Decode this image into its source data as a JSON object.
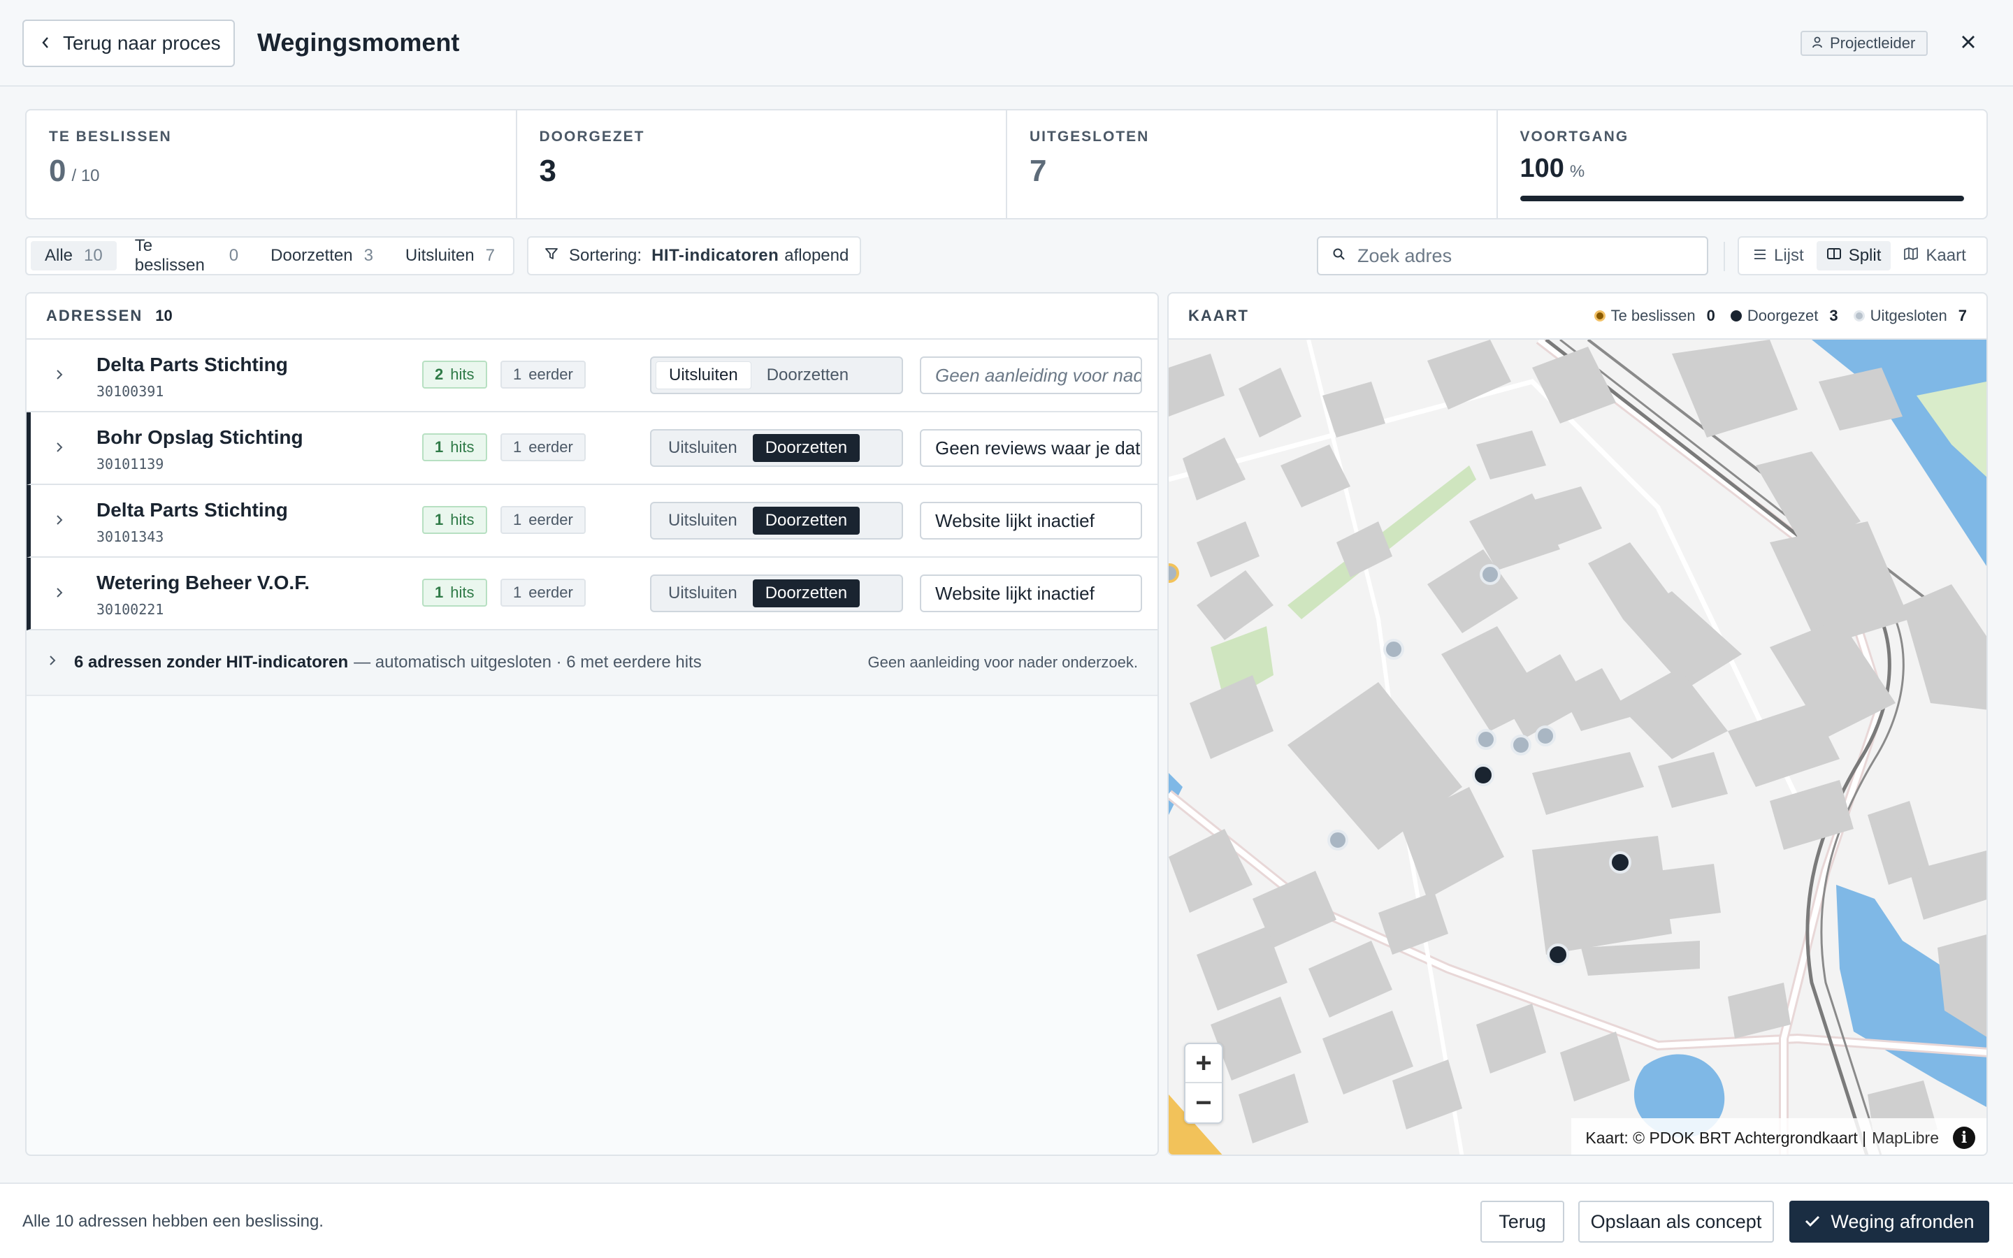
{
  "header": {
    "back_label": "Terug naar proces",
    "title": "Wegingsmoment",
    "role": "Projectleider"
  },
  "stats": {
    "to_decide": {
      "label": "TE BESLISSEN",
      "value": "0",
      "total": "/ 10"
    },
    "forwarded": {
      "label": "DOORGEZET",
      "value": "3"
    },
    "excluded": {
      "label": "UITGESLOTEN",
      "value": "7"
    },
    "progress": {
      "label": "VOORTGANG",
      "value": "100",
      "unit": "%",
      "fraction": 1.0
    }
  },
  "filters": [
    {
      "label": "Alle",
      "count": "10",
      "active": true
    },
    {
      "label": "Te beslissen",
      "count": "0",
      "active": false
    },
    {
      "label": "Doorzetten",
      "count": "3",
      "active": false
    },
    {
      "label": "Uitsluiten",
      "count": "7",
      "active": false
    }
  ],
  "sort": {
    "prefix": "Sortering:",
    "field": "HIT-indicatoren",
    "direction": "aflopend"
  },
  "search": {
    "placeholder": "Zoek adres",
    "value": ""
  },
  "views": [
    {
      "label": "Lijst",
      "icon": "list-icon",
      "active": false
    },
    {
      "label": "Split",
      "icon": "split-icon",
      "active": true
    },
    {
      "label": "Kaart",
      "icon": "map-icon",
      "active": false
    }
  ],
  "list": {
    "heading": "ADRESSEN",
    "count": "10",
    "rows": [
      {
        "name": "Delta Parts Stichting",
        "code": "30100391",
        "hits": "2",
        "hits_label": "hits",
        "prev": "1",
        "prev_label": "eerder",
        "choice": "Uitsluiten",
        "note": "",
        "note_placeholder": "Geen aanleiding voor nader onderzoek"
      },
      {
        "name": "Bohr Opslag Stichting",
        "code": "30101139",
        "hits": "1",
        "hits_label": "hits",
        "prev": "1",
        "prev_label": "eerder",
        "choice": "Doorzetten",
        "note": "Geen reviews waar je dat",
        "note_placeholder": ""
      },
      {
        "name": "Delta Parts Stichting",
        "code": "30101343",
        "hits": "1",
        "hits_label": "hits",
        "prev": "1",
        "prev_label": "eerder",
        "choice": "Doorzetten",
        "note": "Website lijkt inactief",
        "note_placeholder": ""
      },
      {
        "name": "Wetering Beheer V.O.F.",
        "code": "30100221",
        "hits": "1",
        "hits_label": "hits",
        "prev": "1",
        "prev_label": "eerder",
        "choice": "Doorzetten",
        "note": "Website lijkt inactief",
        "note_placeholder": ""
      }
    ],
    "option_exclude": "Uitsluiten",
    "option_forward": "Doorzetten",
    "summary": {
      "strong": "6 adressen zonder HIT-indicatoren",
      "rest": "— automatisch uitgesloten · 6 met eerdere hits",
      "right": "Geen aanleiding voor nader onderzoek."
    }
  },
  "map": {
    "heading": "KAART",
    "legend": [
      {
        "label": "Te beslissen",
        "count": "0",
        "color": "#8a5a00"
      },
      {
        "label": "Doorgezet",
        "count": "3",
        "color": "#1a2430"
      },
      {
        "label": "Uitgesloten",
        "count": "7",
        "color": "#b8c2cc"
      }
    ],
    "attribution": "Kaart: © PDOK BRT Achtergrondkaart |",
    "attribution_link": "MapLibre",
    "zoom_in": "+",
    "zoom_out": "−"
  },
  "footer": {
    "status": "Alle 10 adressen hebben een beslissing.",
    "back": "Terug",
    "save_draft": "Opslaan als concept",
    "finish": "Weging afronden"
  },
  "colors": {
    "dark": "#1a2430",
    "primary": "#1a2d42",
    "hits_green": "#2f7a47",
    "water": "#7fb8e6",
    "building": "#cfcfcf",
    "park": "#cfe5bf"
  }
}
